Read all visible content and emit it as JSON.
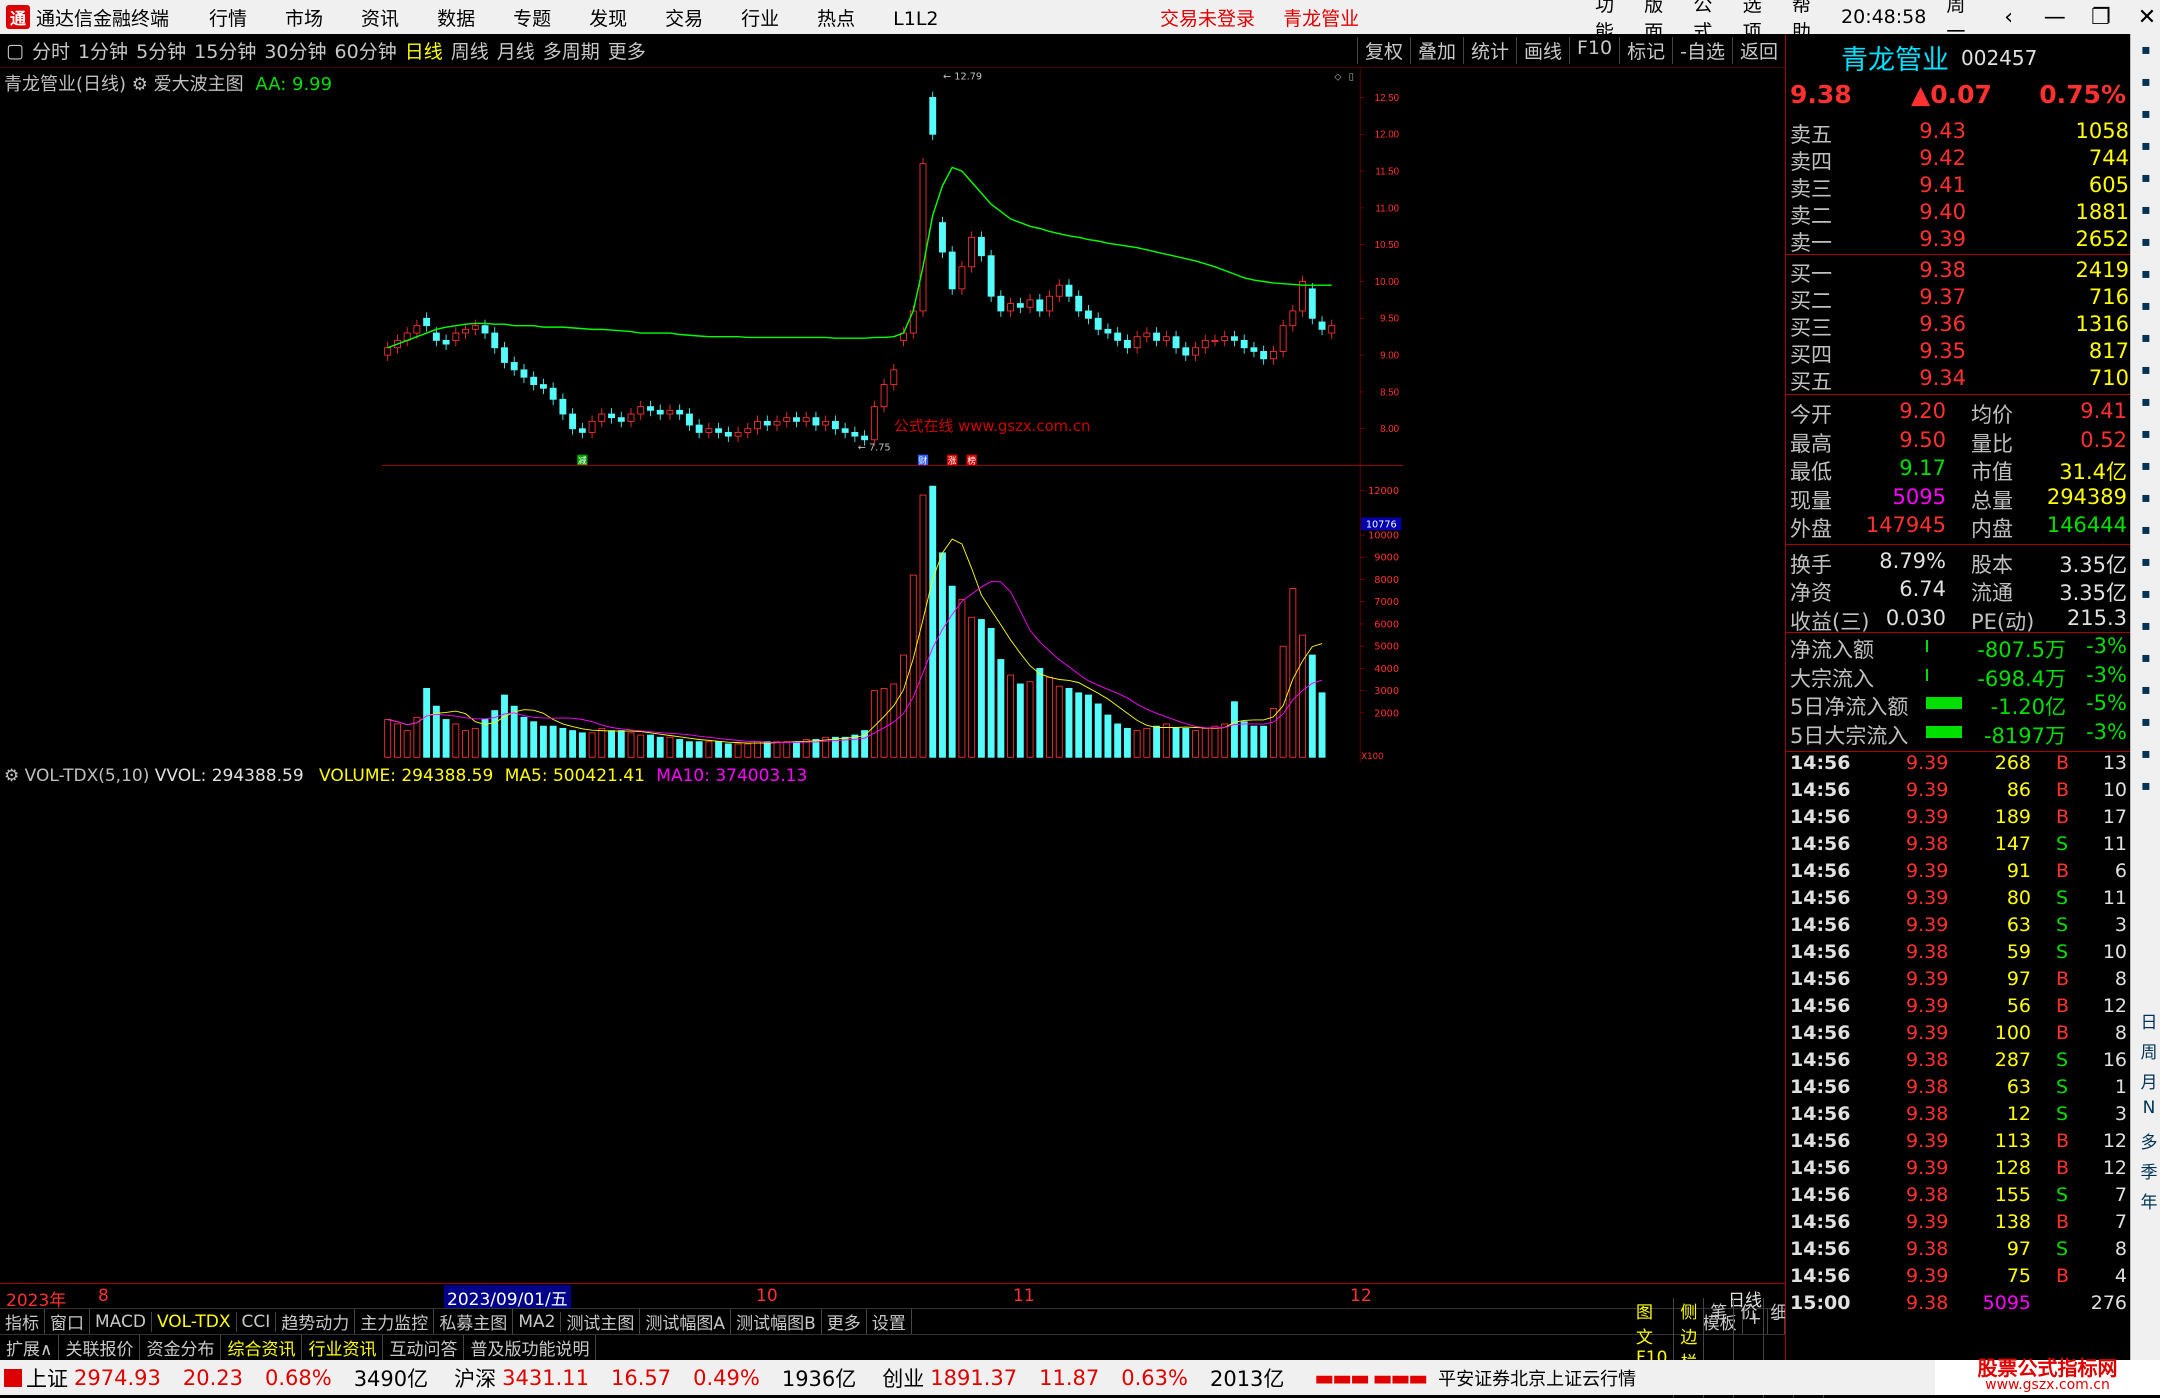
{
  "app": {
    "title": "通达信金融终端",
    "menu": [
      "行情",
      "市场",
      "资讯",
      "数据",
      "专题",
      "发现",
      "交易",
      "行业",
      "热点",
      "L1L2"
    ],
    "notice1": "交易未登录",
    "notice2": "青龙管业",
    "right_menu": [
      "功能",
      "版面",
      "公式",
      "选项",
      "帮助"
    ],
    "time": "20:48:58",
    "weekday": "周一"
  },
  "periods": [
    "分时",
    "1分钟",
    "5分钟",
    "15分钟",
    "30分钟",
    "60分钟",
    "日线",
    "周线",
    "月线",
    "多周期",
    "更多"
  ],
  "active_period": "日线",
  "chart_buttons": [
    "复权",
    "叠加",
    "统计",
    "画线",
    "F10",
    "标记",
    "-自选",
    "返回"
  ],
  "chart_head": {
    "stock": "青龙管业(日线)",
    "indicator": "爱大波主图",
    "aa_label": "AA: 9.99"
  },
  "price_axis": [
    "12.50",
    "12.00",
    "11.50",
    "11.00",
    "10.50",
    "10.00",
    "9.50",
    "9.00",
    "8.50",
    "8.00"
  ],
  "annotations": {
    "high": "12.79",
    "low": "7.75",
    "tag_jian": "减",
    "tag_cai": "财",
    "tag_zhang": "涨",
    "tag_bang": "榜"
  },
  "watermark": "公式在线 www.gszx.com.cn",
  "vol_head": {
    "name": "VOL-TDX(5,10)",
    "vvol": "VVOL: 294388.59",
    "volume": "VOLUME: 294388.59",
    "ma5": "MA5: 500421.41",
    "ma10": "MA10: 374003.13"
  },
  "vol_axis": [
    "12000",
    "10000",
    "9000",
    "8000",
    "7000",
    "6000",
    "5000",
    "4000",
    "3000",
    "2000"
  ],
  "vol_marker": "10776",
  "vol_unit": "X100",
  "time_axis": {
    "year": "2023年",
    "m8": "8",
    "date": "2023/09/01/五",
    "m10": "10",
    "m11": "11",
    "m12": "12",
    "period": "日线"
  },
  "tabs": [
    "指标",
    "窗口",
    "MACD",
    "VOL-TDX",
    "CCI",
    "趋势动力",
    "主力监控",
    "私募主图",
    "MA2",
    "测试主图",
    "测试幅图A",
    "测试幅图B",
    "更多",
    "设置"
  ],
  "tabs_active": "VOL-TDX",
  "tabs_right": [
    "模板",
    "+",
    "-"
  ],
  "ext_tabs": [
    "扩展∧",
    "关联报价",
    "资金分布",
    "综合资讯",
    "行业资讯",
    "互动问答",
    "普及版功能说明"
  ],
  "ext_right": [
    "图文F10",
    "侧边栏《",
    "笔",
    "价",
    "细",
    "势"
  ],
  "quote": {
    "name": "青龙管业",
    "code": "002457",
    "price": "9.38",
    "change": "▲0.07",
    "pct": "0.75%",
    "asks": [
      {
        "l": "卖五",
        "p": "9.43",
        "v": "1058"
      },
      {
        "l": "卖四",
        "p": "9.42",
        "v": "744"
      },
      {
        "l": "卖三",
        "p": "9.41",
        "v": "605"
      },
      {
        "l": "卖二",
        "p": "9.40",
        "v": "1881"
      },
      {
        "l": "卖一",
        "p": "9.39",
        "v": "2652"
      }
    ],
    "bids": [
      {
        "l": "买一",
        "p": "9.38",
        "v": "2419"
      },
      {
        "l": "买二",
        "p": "9.37",
        "v": "716"
      },
      {
        "l": "买三",
        "p": "9.36",
        "v": "1316"
      },
      {
        "l": "买四",
        "p": "9.35",
        "v": "817"
      },
      {
        "l": "买五",
        "p": "9.34",
        "v": "710"
      }
    ],
    "stats": [
      [
        "今开",
        "9.20",
        "均价",
        "9.41"
      ],
      [
        "最高",
        "9.50",
        "量比",
        "0.52"
      ],
      [
        "最低",
        "9.17",
        "市值",
        "31.4亿"
      ],
      [
        "现量",
        "5095",
        "总量",
        "294389"
      ],
      [
        "外盘",
        "147945",
        "内盘",
        "146444"
      ],
      [
        "换手",
        "8.79%",
        "股本",
        "3.35亿"
      ],
      [
        "净资",
        "6.74",
        "流通",
        "3.35亿"
      ],
      [
        "收益(三)",
        "0.030",
        "PE(动)",
        "215.3"
      ]
    ],
    "flows": [
      [
        "净流入额",
        "-807.5万",
        "-3%"
      ],
      [
        "大宗流入",
        "-698.4万",
        "-3%"
      ],
      [
        "5日净流入额",
        "-1.20亿",
        "-5%"
      ],
      [
        "5日大宗流入",
        "-8197万",
        "-3%"
      ]
    ],
    "ticks": [
      [
        "14:56",
        "9.39",
        "268",
        "B",
        "13"
      ],
      [
        "14:56",
        "9.39",
        "86",
        "B",
        "10"
      ],
      [
        "14:56",
        "9.39",
        "189",
        "B",
        "17"
      ],
      [
        "14:56",
        "9.38",
        "147",
        "S",
        "11"
      ],
      [
        "14:56",
        "9.39",
        "91",
        "B",
        "6"
      ],
      [
        "14:56",
        "9.39",
        "80",
        "S",
        "11"
      ],
      [
        "14:56",
        "9.39",
        "63",
        "S",
        "3"
      ],
      [
        "14:56",
        "9.38",
        "59",
        "S",
        "10"
      ],
      [
        "14:56",
        "9.39",
        "97",
        "B",
        "8"
      ],
      [
        "14:56",
        "9.39",
        "56",
        "B",
        "12"
      ],
      [
        "14:56",
        "9.39",
        "100",
        "B",
        "8"
      ],
      [
        "14:56",
        "9.38",
        "287",
        "S",
        "16"
      ],
      [
        "14:56",
        "9.38",
        "63",
        "S",
        "1"
      ],
      [
        "14:56",
        "9.38",
        "12",
        "S",
        "3"
      ],
      [
        "14:56",
        "9.39",
        "113",
        "B",
        "12"
      ],
      [
        "14:56",
        "9.39",
        "128",
        "B",
        "12"
      ],
      [
        "14:56",
        "9.38",
        "155",
        "S",
        "7"
      ],
      [
        "14:56",
        "9.39",
        "138",
        "B",
        "7"
      ],
      [
        "14:56",
        "9.38",
        "97",
        "S",
        "8"
      ],
      [
        "14:56",
        "9.39",
        "75",
        "B",
        "4"
      ],
      [
        "15:00",
        "9.38",
        "5095",
        "",
        "276"
      ]
    ]
  },
  "status": {
    "sh": "上证",
    "sh_v": "2974.93",
    "sh_c": "20.23",
    "sh_p": "0.68%",
    "sh_a": "3490亿",
    "sz": "沪深",
    "sz_v": "3431.11",
    "sz_c": "16.57",
    "sz_p": "0.49%",
    "sz_a": "1936亿",
    "cy": "创业",
    "cy_v": "1891.37",
    "cy_c": "11.87",
    "cy_p": "0.63%",
    "cy_a": "2013亿",
    "broker": "平安证券北京上证云行情",
    "logo": "股票公式指标网",
    "logo_url": "www.gszx.com.cn"
  },
  "side_labels": [
    "日",
    "周",
    "月",
    "N",
    "多",
    "季",
    "年"
  ],
  "chart_data": {
    "type": "bar",
    "candles": [
      [
        9.0,
        9.1
      ],
      [
        9.1,
        9.2
      ],
      [
        9.2,
        9.3
      ],
      [
        9.3,
        9.4
      ],
      [
        9.5,
        9.4
      ],
      [
        9.3,
        9.2
      ],
      [
        9.2,
        9.15
      ],
      [
        9.2,
        9.3
      ],
      [
        9.3,
        9.35
      ],
      [
        9.35,
        9.4
      ],
      [
        9.4,
        9.3
      ],
      [
        9.3,
        9.1
      ],
      [
        9.1,
        8.9
      ],
      [
        8.9,
        8.8
      ],
      [
        8.8,
        8.7
      ],
      [
        8.7,
        8.6
      ],
      [
        8.6,
        8.55
      ],
      [
        8.55,
        8.4
      ],
      [
        8.4,
        8.2
      ],
      [
        8.2,
        8.0
      ],
      [
        8.0,
        7.95
      ],
      [
        7.95,
        8.1
      ],
      [
        8.1,
        8.2
      ],
      [
        8.2,
        8.15
      ],
      [
        8.15,
        8.1
      ],
      [
        8.1,
        8.2
      ],
      [
        8.2,
        8.3
      ],
      [
        8.3,
        8.25
      ],
      [
        8.25,
        8.2
      ],
      [
        8.2,
        8.25
      ],
      [
        8.25,
        8.2
      ],
      [
        8.2,
        8.05
      ],
      [
        8.05,
        7.95
      ],
      [
        7.95,
        8.0
      ],
      [
        8.0,
        7.95
      ],
      [
        7.95,
        7.9
      ],
      [
        7.9,
        7.95
      ],
      [
        7.95,
        8.0
      ],
      [
        8.0,
        8.1
      ],
      [
        8.1,
        8.05
      ],
      [
        8.05,
        8.1
      ],
      [
        8.1,
        8.15
      ],
      [
        8.15,
        8.1
      ],
      [
        8.1,
        8.15
      ],
      [
        8.15,
        8.05
      ],
      [
        8.05,
        8.1
      ],
      [
        8.1,
        8.0
      ],
      [
        8.0,
        7.95
      ],
      [
        7.95,
        7.9
      ],
      [
        7.9,
        7.85
      ],
      [
        7.85,
        8.3
      ],
      [
        8.3,
        8.6
      ],
      [
        8.6,
        8.8
      ],
      [
        9.2,
        9.3
      ],
      [
        9.3,
        9.6
      ],
      [
        9.6,
        11.6
      ],
      [
        12.5,
        12.0
      ],
      [
        10.8,
        10.4
      ],
      [
        10.4,
        9.9
      ],
      [
        9.9,
        10.2
      ],
      [
        10.2,
        10.6
      ],
      [
        10.6,
        10.35
      ],
      [
        10.35,
        9.8
      ],
      [
        9.8,
        9.6
      ],
      [
        9.6,
        9.7
      ],
      [
        9.7,
        9.65
      ],
      [
        9.65,
        9.75
      ],
      [
        9.75,
        9.6
      ],
      [
        9.6,
        9.8
      ],
      [
        9.8,
        9.95
      ],
      [
        9.95,
        9.8
      ],
      [
        9.8,
        9.6
      ],
      [
        9.6,
        9.5
      ],
      [
        9.5,
        9.35
      ],
      [
        9.35,
        9.3
      ],
      [
        9.3,
        9.2
      ],
      [
        9.2,
        9.1
      ],
      [
        9.1,
        9.25
      ],
      [
        9.25,
        9.3
      ],
      [
        9.3,
        9.2
      ],
      [
        9.2,
        9.25
      ],
      [
        9.25,
        9.1
      ],
      [
        9.1,
        9.0
      ],
      [
        9.0,
        9.1
      ],
      [
        9.1,
        9.2
      ],
      [
        9.2,
        9.2
      ],
      [
        9.2,
        9.25
      ],
      [
        9.25,
        9.2
      ],
      [
        9.2,
        9.1
      ],
      [
        9.1,
        9.05
      ],
      [
        9.05,
        8.95
      ],
      [
        8.95,
        9.05
      ],
      [
        9.05,
        9.4
      ],
      [
        9.4,
        9.6
      ],
      [
        9.6,
        10.0
      ],
      [
        9.9,
        9.5
      ],
      [
        9.45,
        9.35
      ],
      [
        9.3,
        9.4
      ]
    ],
    "ma_line": [
      9.1,
      9.15,
      9.2,
      9.25,
      9.3,
      9.35,
      9.38,
      9.4,
      9.42,
      9.43,
      9.43,
      9.42,
      9.42,
      9.4,
      9.4,
      9.4,
      9.38,
      9.38,
      9.38,
      9.37,
      9.36,
      9.35,
      9.35,
      9.34,
      9.33,
      9.32,
      9.3,
      9.3,
      9.3,
      9.3,
      9.28,
      9.27,
      9.26,
      9.25,
      9.25,
      9.25,
      9.25,
      9.24,
      9.24,
      9.24,
      9.24,
      9.24,
      9.24,
      9.24,
      9.24,
      9.24,
      9.23,
      9.23,
      9.23,
      9.23,
      9.24,
      9.24,
      9.25,
      9.3,
      9.6,
      10.2,
      10.9,
      11.3,
      11.55,
      11.5,
      11.35,
      11.2,
      11.05,
      10.95,
      10.85,
      10.8,
      10.75,
      10.72,
      10.68,
      10.65,
      10.62,
      10.6,
      10.57,
      10.55,
      10.52,
      10.5,
      10.48,
      10.46,
      10.43,
      10.4,
      10.37,
      10.34,
      10.31,
      10.28,
      10.24,
      10.2,
      10.15,
      10.1,
      10.05,
      10.02,
      10.0,
      9.98,
      9.97,
      9.96,
      9.95,
      9.95,
      9.95,
      9.95
    ],
    "volume": [
      1700,
      1500,
      1200,
      1800,
      3100,
      2300,
      1700,
      1500,
      1200,
      1300,
      1700,
      2100,
      2800,
      2300,
      1800,
      1600,
      1400,
      1400,
      1300,
      1200,
      1100,
      1100,
      1300,
      1200,
      1200,
      1100,
      1000,
      1000,
      900,
      900,
      800,
      700,
      700,
      700,
      700,
      600,
      600,
      600,
      700,
      700,
      700,
      700,
      700,
      800,
      800,
      900,
      900,
      900,
      1000,
      1200,
      3000,
      3100,
      3300,
      4600,
      8200,
      11800,
      12200,
      9200,
      7700,
      7100,
      6300,
      6200,
      5800,
      4400,
      3700,
      3300,
      3400,
      4000,
      3600,
      3200,
      3100,
      2900,
      2800,
      2400,
      1900,
      1500,
      1300,
      1200,
      1300,
      1400,
      1500,
      1300,
      1300,
      1200,
      1300,
      1400,
      1500,
      2500,
      1600,
      1400,
      1400,
      2200,
      5000,
      7600,
      5500,
      4600,
      2900
    ],
    "ylim": [
      7.5,
      12.9
    ],
    "vol_ylim": [
      0,
      13000
    ]
  }
}
